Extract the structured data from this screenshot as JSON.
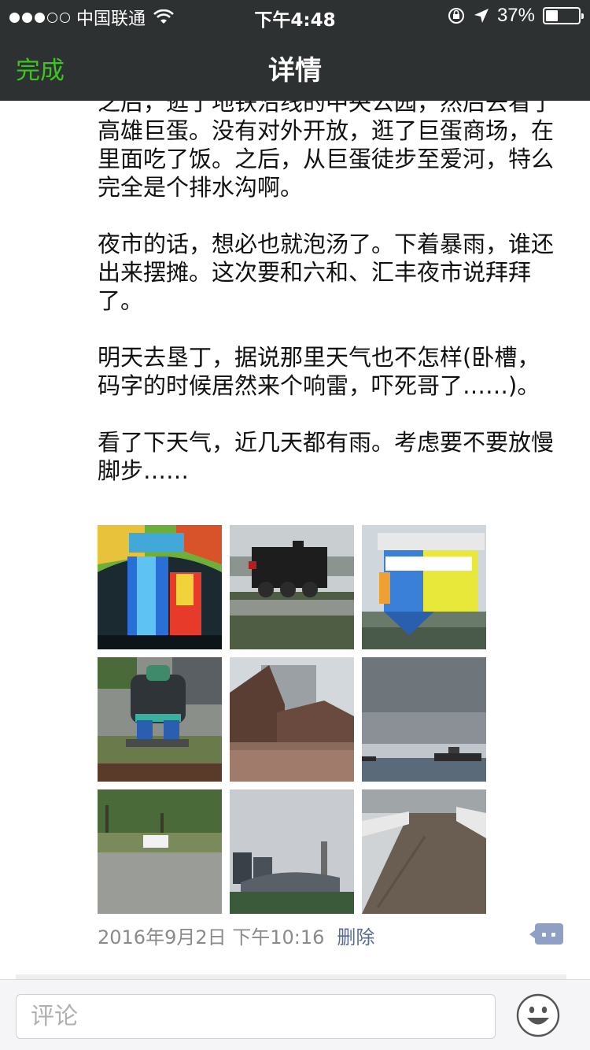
{
  "status_bar": {
    "carrier": "中国联通",
    "time": "下午4:48",
    "battery_text": "37%",
    "battery_level": 0.37
  },
  "nav": {
    "done_label": "完成",
    "title": "详情"
  },
  "post": {
    "text": "之后，逛了地铁沿线的中央公园，然后去看了高雄巨蛋。没有对外开放，逛了巨蛋商场，在里面吃了饭。之后，从巨蛋徒步至爱河，特么完全是个排水沟啊。\n\n夜市的话，想必也就泡汤了。下着暴雨，谁还出来摆摊。这次要和六和、汇丰夜市说拜拜了。\n\n明天去垦丁，据说那里天气也不怎样(卧槽，码字的时候居然来个响雷，吓死哥了……)。\n\n看了下天气，近几天都有雨。考虑要不要放慢脚步……",
    "timestamp": "2016年9月2日 下午10:16",
    "delete_label": "删除",
    "photos": [
      {
        "subject": "rainbow glass dome"
      },
      {
        "subject": "steam locomotive"
      },
      {
        "subject": "upside-down house"
      },
      {
        "subject": "armor figure statue"
      },
      {
        "subject": "warehouse buildings"
      },
      {
        "subject": "harbor with ships"
      },
      {
        "subject": "park in rain"
      },
      {
        "subject": "stadium"
      },
      {
        "subject": "wooden boardwalk"
      }
    ]
  },
  "comment_bar": {
    "placeholder": "评论",
    "emoji_icon": "smiley-face-icon"
  },
  "colors": {
    "header_bg": "#2e3132",
    "accent_green": "#3cc51f",
    "link_blue": "#576b95"
  }
}
